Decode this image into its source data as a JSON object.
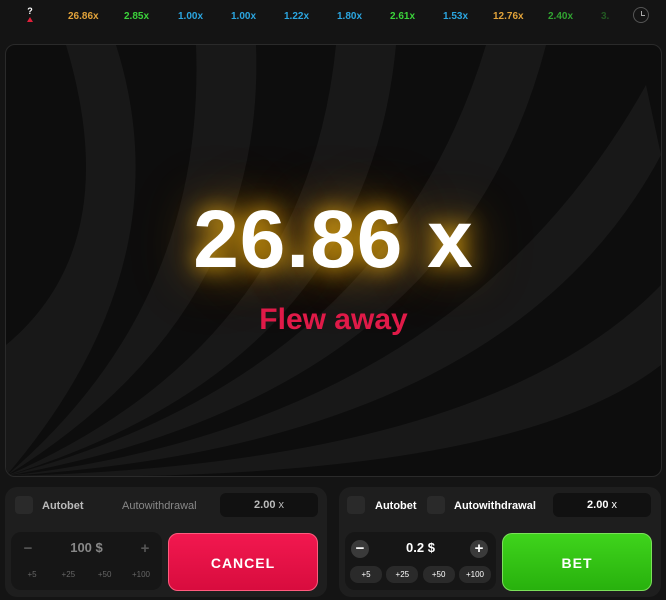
{
  "history": {
    "current": "?",
    "items": [
      {
        "value": "26.86x",
        "color": "#e2a33a"
      },
      {
        "value": "2.85x",
        "color": "#3bd33b"
      },
      {
        "value": "1.00x",
        "color": "#2ba6e0"
      },
      {
        "value": "1.00x",
        "color": "#2ba6e0"
      },
      {
        "value": "1.22x",
        "color": "#2ba6e0"
      },
      {
        "value": "1.80x",
        "color": "#2ba6e0"
      },
      {
        "value": "2.61x",
        "color": "#3bd33b"
      },
      {
        "value": "1.53x",
        "color": "#2ba6e0"
      },
      {
        "value": "12.76x",
        "color": "#e2a33a"
      },
      {
        "value": "2.40x",
        "color": "#3bd33b"
      },
      {
        "value": "3.",
        "color": "#3bd33b"
      }
    ]
  },
  "game": {
    "multiplier": "26.86 x",
    "status": "Flew away"
  },
  "panels": {
    "left": {
      "autobet_label": "Autobet",
      "autowithdrawal_label": "Autowithdrawal",
      "autowithdrawal_value": "2.00",
      "autowithdrawal_unit": "x",
      "stake_value": "100",
      "stake_currency": "$",
      "minus": "−",
      "plus": "+",
      "chips": [
        "+5",
        "+25",
        "+50",
        "+100"
      ],
      "action_label": "CANCEL"
    },
    "right": {
      "autobet_label": "Autobet",
      "autowithdrawal_label": "Autowithdrawal",
      "autowithdrawal_value": "2.00",
      "autowithdrawal_unit": "x",
      "stake_value": "0.2",
      "stake_currency": "$",
      "minus": "−",
      "plus": "+",
      "chips": [
        "+5",
        "+25",
        "+50",
        "+100"
      ],
      "action_label": "BET"
    }
  },
  "colors": {
    "cancel": "#e8144a",
    "bet": "#33c215",
    "flew_away": "#e01a48",
    "glow": "#ffbe14"
  },
  "icons": [
    "clock-icon"
  ]
}
